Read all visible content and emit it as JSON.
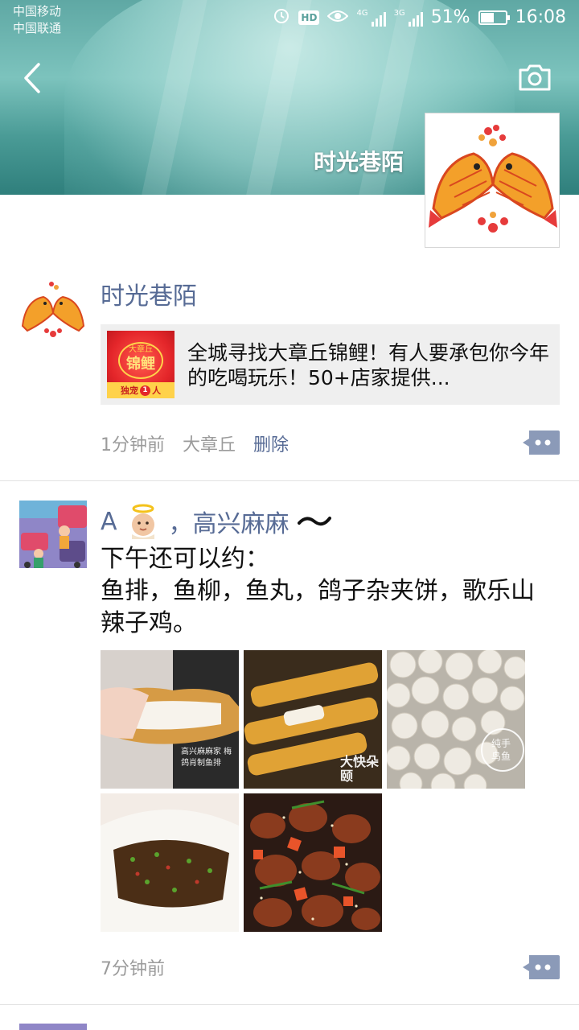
{
  "status_bar": {
    "carrier_1": "中国移动",
    "carrier_2": "中国联通",
    "hd_badge": "HD",
    "net_1": "4G",
    "net_2": "3G",
    "battery_percent": "51%",
    "time": "16:08"
  },
  "cover": {
    "name": "时光巷陌",
    "back_icon": "back-chevron-icon",
    "camera_icon": "camera-icon"
  },
  "posts": [
    {
      "author": "时光巷陌",
      "share": {
        "title": "全城寻找大章丘锦鲤！有人要承包你今年的吃喝玩乐！50+店家提供...",
        "thumb_top": "大章丘",
        "thumb_main": "锦鲤",
        "thumb_bottom": "独宠",
        "thumb_num": "1",
        "thumb_unit": "人"
      },
      "time": "1分钟前",
      "location": "大章丘",
      "delete_label": "删除"
    },
    {
      "author_prefix": "A",
      "author_suffix": "，高兴麻麻",
      "text": "下午还可以约：\n鱼排，鱼柳，鱼丸，鸽子杂夹饼，歌乐山辣子鸡。",
      "photos": [
        {
          "icon": "fried-fish-fillet-photo",
          "watermark": "高兴麻麻家 梅鸽肖制鱼排"
        },
        {
          "icon": "fish-fingers-photo",
          "watermark": "大快朵颐"
        },
        {
          "icon": "fish-balls-photo",
          "watermark": "纯手 鸟鱼"
        },
        {
          "icon": "sandwich-bun-photo",
          "watermark": ""
        },
        {
          "icon": "spicy-chicken-photo",
          "watermark": ""
        }
      ],
      "time": "7分钟前"
    }
  ],
  "colors": {
    "link": "#576b95",
    "meta": "#9b9b9b",
    "share_bg": "#efefef"
  }
}
